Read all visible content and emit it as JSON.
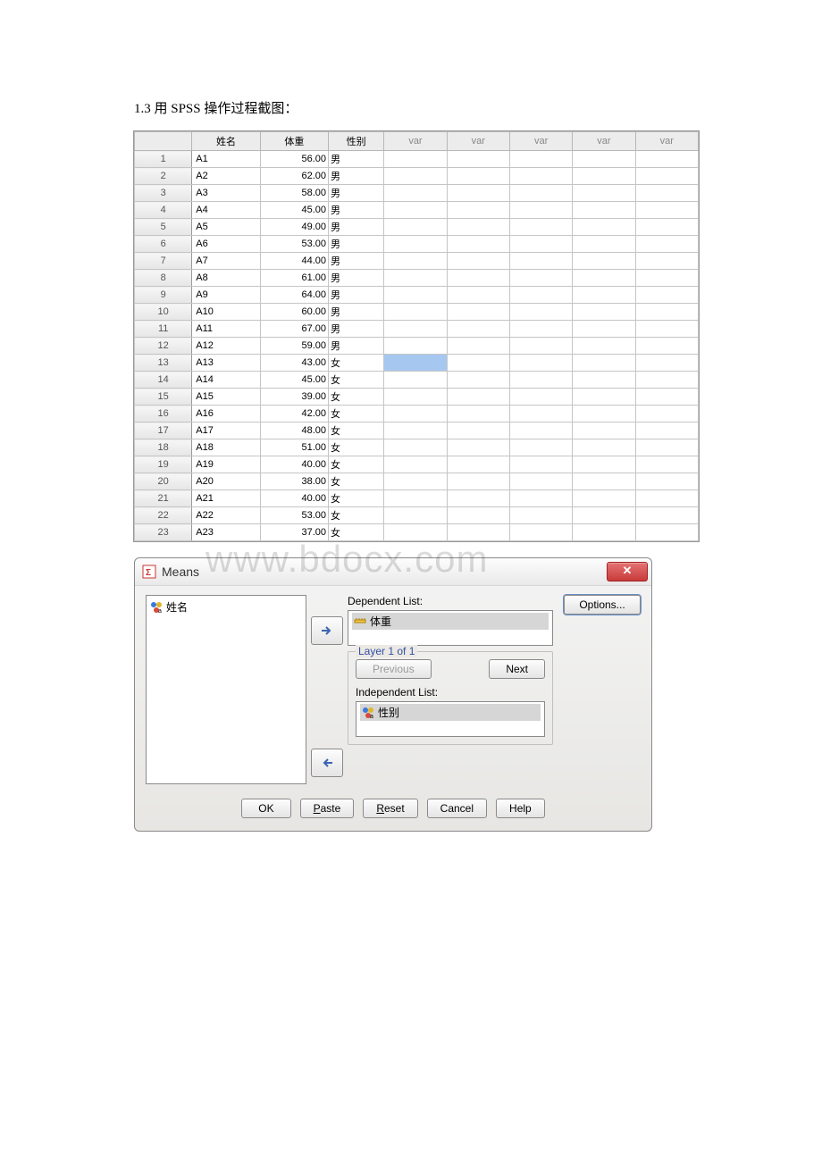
{
  "heading": "1.3 用 SPSS 操作过程截图：",
  "watermark": "www.bdocx.com",
  "data_view": {
    "columns": {
      "name": "姓名",
      "weight": "体重",
      "gender": "性别",
      "var": "var"
    },
    "selected_cell": {
      "row_index": 12,
      "col": "var1"
    },
    "rows": [
      {
        "n": "1",
        "name": "A1",
        "weight": "56.00",
        "gender": "男"
      },
      {
        "n": "2",
        "name": "A2",
        "weight": "62.00",
        "gender": "男"
      },
      {
        "n": "3",
        "name": "A3",
        "weight": "58.00",
        "gender": "男"
      },
      {
        "n": "4",
        "name": "A4",
        "weight": "45.00",
        "gender": "男"
      },
      {
        "n": "5",
        "name": "A5",
        "weight": "49.00",
        "gender": "男"
      },
      {
        "n": "6",
        "name": "A6",
        "weight": "53.00",
        "gender": "男"
      },
      {
        "n": "7",
        "name": "A7",
        "weight": "44.00",
        "gender": "男"
      },
      {
        "n": "8",
        "name": "A8",
        "weight": "61.00",
        "gender": "男"
      },
      {
        "n": "9",
        "name": "A9",
        "weight": "64.00",
        "gender": "男"
      },
      {
        "n": "10",
        "name": "A10",
        "weight": "60.00",
        "gender": "男"
      },
      {
        "n": "11",
        "name": "A11",
        "weight": "67.00",
        "gender": "男"
      },
      {
        "n": "12",
        "name": "A12",
        "weight": "59.00",
        "gender": "男"
      },
      {
        "n": "13",
        "name": "A13",
        "weight": "43.00",
        "gender": "女"
      },
      {
        "n": "14",
        "name": "A14",
        "weight": "45.00",
        "gender": "女"
      },
      {
        "n": "15",
        "name": "A15",
        "weight": "39.00",
        "gender": "女"
      },
      {
        "n": "16",
        "name": "A16",
        "weight": "42.00",
        "gender": "女"
      },
      {
        "n": "17",
        "name": "A17",
        "weight": "48.00",
        "gender": "女"
      },
      {
        "n": "18",
        "name": "A18",
        "weight": "51.00",
        "gender": "女"
      },
      {
        "n": "19",
        "name": "A19",
        "weight": "40.00",
        "gender": "女"
      },
      {
        "n": "20",
        "name": "A20",
        "weight": "38.00",
        "gender": "女"
      },
      {
        "n": "21",
        "name": "A21",
        "weight": "40.00",
        "gender": "女"
      },
      {
        "n": "22",
        "name": "A22",
        "weight": "53.00",
        "gender": "女"
      },
      {
        "n": "23",
        "name": "A23",
        "weight": "37.00",
        "gender": "女"
      }
    ]
  },
  "dialog": {
    "title": "Means",
    "source_var": "姓名",
    "dependent_label": "Dependent List:",
    "dependent_item": "体重",
    "layer_label": "Layer 1 of 1",
    "previous": "Previous",
    "next": "Next",
    "independent_label": "Independent List:",
    "independent_item": "性别",
    "options": "Options...",
    "buttons": {
      "ok": "OK",
      "paste": "Paste",
      "reset": "Reset",
      "cancel": "Cancel",
      "help": "Help"
    }
  }
}
